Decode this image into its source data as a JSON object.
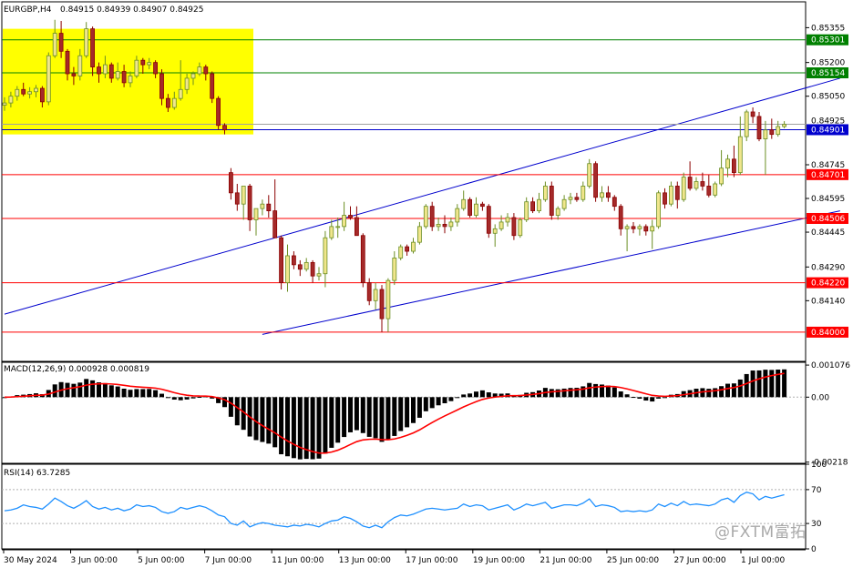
{
  "header": {
    "symbol": "EURGBP,H4",
    "quote": "0.84915 0.84939 0.84907 0.84925"
  },
  "chart_data": [
    {
      "type": "candlestick",
      "symbol": "EURGBP",
      "timeframe": "H4",
      "yticks": [
        0.85355,
        0.852,
        0.8505,
        0.84745,
        0.84595,
        0.84445,
        0.8429,
        0.8414
      ],
      "ytick_labels": [
        "0.85355",
        "0.85200",
        "0.85050",
        "0.84745",
        "0.84595",
        "0.84445",
        "0.84290",
        "0.84140"
      ],
      "ylim": [
        0.8387,
        0.8547
      ],
      "xtick_labels": [
        "30 May 2024",
        "3 Jun 00:00",
        "5 Jun 00:00",
        "7 Jun 00:00",
        "11 Jun 00:00",
        "13 Jun 00:00",
        "17 Jun 00:00",
        "19 Jun 00:00",
        "21 Jun 00:00",
        "25 Jun 00:00",
        "27 Jun 00:00",
        "1 Jul 00:00"
      ],
      "colors": {
        "up": "#6b8e23",
        "up_body": "#f0e68c",
        "down": "#8b0000",
        "down_body": "#a52a2a"
      },
      "horizontal_levels": [
        {
          "value": 0.85301,
          "label": "0.85301",
          "color": "#008000"
        },
        {
          "value": 0.85154,
          "label": "0.85154",
          "color": "#008000"
        },
        {
          "value": 0.84901,
          "label": "0.84901",
          "color": "#0000cd"
        },
        {
          "value": 0.84701,
          "label": "0.84701",
          "color": "#ff0000"
        },
        {
          "value": 0.84506,
          "label": "0.84506",
          "color": "#ff0000"
        },
        {
          "value": 0.8422,
          "label": "0.84220",
          "color": "#ff0000"
        },
        {
          "value": 0.84,
          "label": "0.84000",
          "color": "#ff0000"
        }
      ],
      "current_price": {
        "value": 0.84925,
        "label": "0.84925"
      },
      "highlight_zone": {
        "from": 0.8488,
        "to": 0.8535,
        "color": "#ffff00"
      },
      "trend_channel": [
        {
          "from": [
            0,
            0.8408
          ],
          "to": [
            132,
            0.8513
          ],
          "color": "#0000cd"
        },
        {
          "from": [
            41,
            0.8399
          ],
          "to": [
            132,
            0.8454
          ],
          "color": "#0000cd"
        }
      ],
      "ohlc": [
        [
          0.8501,
          0.85045,
          0.84985,
          0.8502
        ],
        [
          0.8502,
          0.8507,
          0.85,
          0.8505
        ],
        [
          0.8505,
          0.85095,
          0.8503,
          0.8508
        ],
        [
          0.8508,
          0.8511,
          0.8505,
          0.8506
        ],
        [
          0.8506,
          0.8509,
          0.8504,
          0.8507
        ],
        [
          0.8507,
          0.851,
          0.85045,
          0.85085
        ],
        [
          0.85085,
          0.85095,
          0.85,
          0.85025
        ],
        [
          0.85025,
          0.85245,
          0.8501,
          0.8523
        ],
        [
          0.8523,
          0.8539,
          0.8522,
          0.8533
        ],
        [
          0.8533,
          0.85385,
          0.8522,
          0.8525
        ],
        [
          0.8525,
          0.8526,
          0.8512,
          0.8515
        ],
        [
          0.8515,
          0.8518,
          0.851,
          0.8514
        ],
        [
          0.8514,
          0.8526,
          0.8512,
          0.8523
        ],
        [
          0.8523,
          0.8538,
          0.8522,
          0.8535
        ],
        [
          0.8535,
          0.8536,
          0.8514,
          0.8518
        ],
        [
          0.8518,
          0.852,
          0.8511,
          0.8515
        ],
        [
          0.8515,
          0.8523,
          0.8513,
          0.8519
        ],
        [
          0.8519,
          0.852,
          0.8511,
          0.8513
        ],
        [
          0.8513,
          0.852,
          0.8512,
          0.8516
        ],
        [
          0.8516,
          0.8519,
          0.8509,
          0.8511
        ],
        [
          0.8511,
          0.8516,
          0.8509,
          0.8514
        ],
        [
          0.8514,
          0.8523,
          0.8513,
          0.8521
        ],
        [
          0.8521,
          0.8522,
          0.8515,
          0.8519
        ],
        [
          0.8519,
          0.8522,
          0.8517,
          0.852
        ],
        [
          0.852,
          0.8521,
          0.8513,
          0.8515
        ],
        [
          0.8515,
          0.8517,
          0.8501,
          0.8504
        ],
        [
          0.8504,
          0.8506,
          0.8498,
          0.85
        ],
        [
          0.85,
          0.8507,
          0.8499,
          0.8504
        ],
        [
          0.8504,
          0.8521,
          0.8503,
          0.8508
        ],
        [
          0.8508,
          0.8515,
          0.8506,
          0.8513
        ],
        [
          0.8513,
          0.8516,
          0.851,
          0.8515
        ],
        [
          0.8515,
          0.852,
          0.8514,
          0.8518
        ],
        [
          0.8518,
          0.8519,
          0.8512,
          0.8515
        ],
        [
          0.8515,
          0.8516,
          0.8502,
          0.8504
        ],
        [
          0.8504,
          0.8505,
          0.849,
          0.8492
        ],
        [
          0.8492,
          0.8493,
          0.8488,
          0.849
        ],
        [
          0.8471,
          0.8473,
          0.8459,
          0.8462
        ],
        [
          0.8462,
          0.8466,
          0.8454,
          0.8457
        ],
        [
          0.8457,
          0.8464,
          0.845,
          0.8465
        ],
        [
          0.8465,
          0.8466,
          0.8445,
          0.845
        ],
        [
          0.845,
          0.8453,
          0.8443,
          0.8455
        ],
        [
          0.8455,
          0.8459,
          0.8452,
          0.8457
        ],
        [
          0.8457,
          0.8461,
          0.8451,
          0.8454
        ],
        [
          0.8454,
          0.8468,
          0.8442,
          0.8442
        ],
        [
          0.8442,
          0.8443,
          0.8419,
          0.8422
        ],
        [
          0.8422,
          0.8439,
          0.8418,
          0.8434
        ],
        [
          0.8434,
          0.8436,
          0.8428,
          0.843
        ],
        [
          0.843,
          0.8432,
          0.8425,
          0.8428
        ],
        [
          0.8428,
          0.8433,
          0.8427,
          0.8431
        ],
        [
          0.8431,
          0.8432,
          0.8422,
          0.8425
        ],
        [
          0.8425,
          0.8429,
          0.8423,
          0.8426
        ],
        [
          0.8426,
          0.8445,
          0.842,
          0.8442
        ],
        [
          0.8442,
          0.845,
          0.8441,
          0.8447
        ],
        [
          0.8447,
          0.8451,
          0.8442,
          0.8447
        ],
        [
          0.8447,
          0.8458,
          0.8445,
          0.8452
        ],
        [
          0.8452,
          0.8456,
          0.845,
          0.8451
        ],
        [
          0.8451,
          0.8456,
          0.8443,
          0.8443
        ],
        [
          0.8443,
          0.8444,
          0.842,
          0.8422
        ],
        [
          0.8422,
          0.8424,
          0.8412,
          0.8414
        ],
        [
          0.8414,
          0.8422,
          0.841,
          0.8419
        ],
        [
          0.8419,
          0.8421,
          0.84,
          0.8406
        ],
        [
          0.8406,
          0.8424,
          0.84,
          0.8423
        ],
        [
          0.8423,
          0.8436,
          0.8421,
          0.8433
        ],
        [
          0.8433,
          0.8439,
          0.8432,
          0.8438
        ],
        [
          0.8438,
          0.8439,
          0.8434,
          0.8436
        ],
        [
          0.8436,
          0.8442,
          0.8435,
          0.844
        ],
        [
          0.844,
          0.8449,
          0.8439,
          0.8447
        ],
        [
          0.8447,
          0.8457,
          0.8446,
          0.8456
        ],
        [
          0.8456,
          0.8458,
          0.8445,
          0.8447
        ],
        [
          0.8447,
          0.8451,
          0.8445,
          0.8448
        ],
        [
          0.8448,
          0.8452,
          0.8444,
          0.8447
        ],
        [
          0.8447,
          0.8451,
          0.8445,
          0.8449
        ],
        [
          0.8449,
          0.8457,
          0.8447,
          0.8455
        ],
        [
          0.8455,
          0.8463,
          0.8454,
          0.8459
        ],
        [
          0.8459,
          0.846,
          0.8451,
          0.8452
        ],
        [
          0.8452,
          0.846,
          0.8451,
          0.8457
        ],
        [
          0.8457,
          0.8458,
          0.8454,
          0.8456
        ],
        [
          0.8456,
          0.8457,
          0.8442,
          0.8444
        ],
        [
          0.8444,
          0.8448,
          0.8438,
          0.8446
        ],
        [
          0.8446,
          0.8452,
          0.8445,
          0.8449
        ],
        [
          0.8449,
          0.8453,
          0.8447,
          0.8451
        ],
        [
          0.8451,
          0.8453,
          0.8441,
          0.8443
        ],
        [
          0.8443,
          0.8451,
          0.8442,
          0.845
        ],
        [
          0.845,
          0.846,
          0.8449,
          0.8458
        ],
        [
          0.8458,
          0.846,
          0.8453,
          0.8454
        ],
        [
          0.8454,
          0.8462,
          0.8453,
          0.8459
        ],
        [
          0.8459,
          0.8467,
          0.8458,
          0.8465
        ],
        [
          0.8465,
          0.8467,
          0.845,
          0.8452
        ],
        [
          0.8452,
          0.8456,
          0.845,
          0.8455
        ],
        [
          0.8455,
          0.8461,
          0.8454,
          0.8459
        ],
        [
          0.8459,
          0.8462,
          0.8457,
          0.846
        ],
        [
          0.846,
          0.8462,
          0.8458,
          0.8459
        ],
        [
          0.8459,
          0.8467,
          0.8458,
          0.8465
        ],
        [
          0.8465,
          0.8477,
          0.8464,
          0.8475
        ],
        [
          0.8475,
          0.8476,
          0.8458,
          0.846
        ],
        [
          0.846,
          0.8465,
          0.8458,
          0.8462
        ],
        [
          0.8462,
          0.8465,
          0.8458,
          0.846
        ],
        [
          0.846,
          0.8461,
          0.8454,
          0.8456
        ],
        [
          0.8456,
          0.8457,
          0.8443,
          0.8446
        ],
        [
          0.8446,
          0.8448,
          0.8436,
          0.8447
        ],
        [
          0.8447,
          0.8449,
          0.8444,
          0.8446
        ],
        [
          0.8446,
          0.8448,
          0.8443,
          0.8447
        ],
        [
          0.8447,
          0.8448,
          0.8443,
          0.8445
        ],
        [
          0.8445,
          0.845,
          0.8437,
          0.8447
        ],
        [
          0.8447,
          0.8463,
          0.8446,
          0.8462
        ],
        [
          0.8462,
          0.8464,
          0.8455,
          0.8457
        ],
        [
          0.8457,
          0.8467,
          0.8456,
          0.8465
        ],
        [
          0.8465,
          0.8467,
          0.8455,
          0.8459
        ],
        [
          0.8459,
          0.8471,
          0.8458,
          0.8469
        ],
        [
          0.8469,
          0.8476,
          0.8463,
          0.8464
        ],
        [
          0.8464,
          0.8469,
          0.8463,
          0.8467
        ],
        [
          0.8467,
          0.8471,
          0.8463,
          0.8465
        ],
        [
          0.8465,
          0.847,
          0.846,
          0.8461
        ],
        [
          0.8461,
          0.8467,
          0.846,
          0.8466
        ],
        [
          0.8466,
          0.8481,
          0.8465,
          0.8473
        ],
        [
          0.8473,
          0.8479,
          0.8469,
          0.8477
        ],
        [
          0.8477,
          0.8483,
          0.8469,
          0.8471
        ],
        [
          0.8471,
          0.8496,
          0.847,
          0.8487
        ],
        [
          0.8487,
          0.8499,
          0.8485,
          0.8498
        ],
        [
          0.8498,
          0.85,
          0.8493,
          0.8496
        ],
        [
          0.8496,
          0.8498,
          0.8485,
          0.8486
        ],
        [
          0.8486,
          0.8494,
          0.847,
          0.849
        ],
        [
          0.849,
          0.8495,
          0.8486,
          0.8488
        ],
        [
          0.8488,
          0.8494,
          0.8487,
          0.84915
        ],
        [
          0.84915,
          0.84939,
          0.84907,
          0.84925
        ]
      ]
    },
    {
      "type": "bar",
      "label": "MACD(12,26,9) 0.000928 0.000819",
      "ytick_labels": [
        "0.001076",
        "0.00",
        "-0.00218"
      ],
      "ylim": [
        -0.00222,
        0.00117
      ],
      "signal_color": "#ff0000"
    },
    {
      "type": "line",
      "label": "RSI(14) 63.7285",
      "ytick_labels": [
        "100",
        "70",
        "30",
        "0"
      ],
      "ylim": [
        0,
        100
      ],
      "levels": [
        70,
        30
      ],
      "color": "#1e90ff",
      "values": [
        45,
        46,
        48,
        52,
        50,
        49,
        47,
        53,
        60,
        56,
        51,
        48,
        52,
        57,
        50,
        47,
        49,
        46,
        48,
        45,
        47,
        52,
        50,
        51,
        49,
        44,
        42,
        44,
        49,
        47,
        49,
        51,
        49,
        45,
        40,
        38,
        30,
        28,
        33,
        26,
        29,
        31,
        30,
        28,
        27,
        26,
        28,
        27,
        29,
        28,
        26,
        30,
        33,
        34,
        38,
        36,
        32,
        27,
        25,
        28,
        25,
        32,
        37,
        40,
        39,
        41,
        44,
        47,
        48,
        47,
        46,
        47,
        48,
        53,
        50,
        52,
        51,
        46,
        48,
        50,
        52,
        46,
        49,
        53,
        51,
        53,
        55,
        48,
        50,
        52,
        52,
        51,
        54,
        59,
        50,
        52,
        51,
        49,
        44,
        45,
        44,
        45,
        44,
        46,
        53,
        50,
        54,
        51,
        56,
        52,
        53,
        52,
        51,
        53,
        58,
        60,
        55,
        63,
        67,
        65,
        58,
        62,
        60,
        62,
        64
      ]
    }
  ],
  "watermark": "@FXTM富拓"
}
